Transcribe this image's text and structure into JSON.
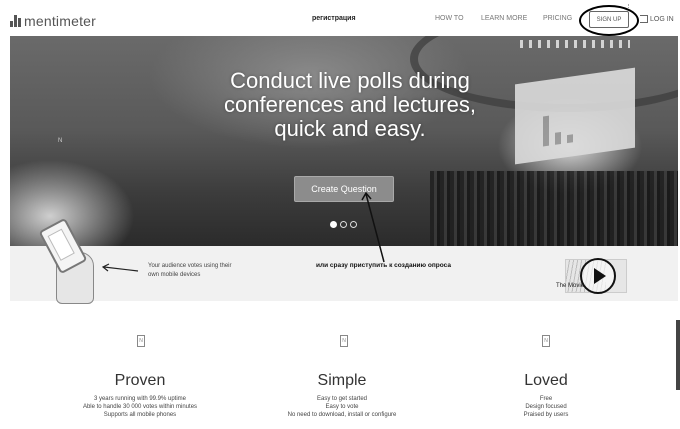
{
  "nav": {
    "logo_text": "mentimeter",
    "annotation": "регистрация",
    "links": [
      "HOW TO",
      "LEARN MORE",
      "PRICING"
    ],
    "signup": "SIGN UP",
    "login": "LOG IN"
  },
  "hero": {
    "title_line1": "Conduct live polls during",
    "title_line2": "conferences and lectures,",
    "title_line3": "quick and easy.",
    "button": "Create Question",
    "slides": 3,
    "active_slide": 1
  },
  "strip": {
    "votes_text": "Your audience votes using their own mobile devices",
    "russian_text": "или сразу приступить к созданию опроса",
    "movie_label": "The Movie"
  },
  "features": [
    {
      "title": "Proven",
      "lines": [
        "3 years running with 99.9% uptime",
        "Able to handle 30 000 votes within minutes",
        "Supports all mobile phones"
      ]
    },
    {
      "title": "Simple",
      "lines": [
        "Easy to get started",
        "Easy to vote",
        "No need to download, install or configure"
      ]
    },
    {
      "title": "Loved",
      "lines": [
        "Free",
        "Design focused",
        "Praised by users"
      ]
    }
  ]
}
